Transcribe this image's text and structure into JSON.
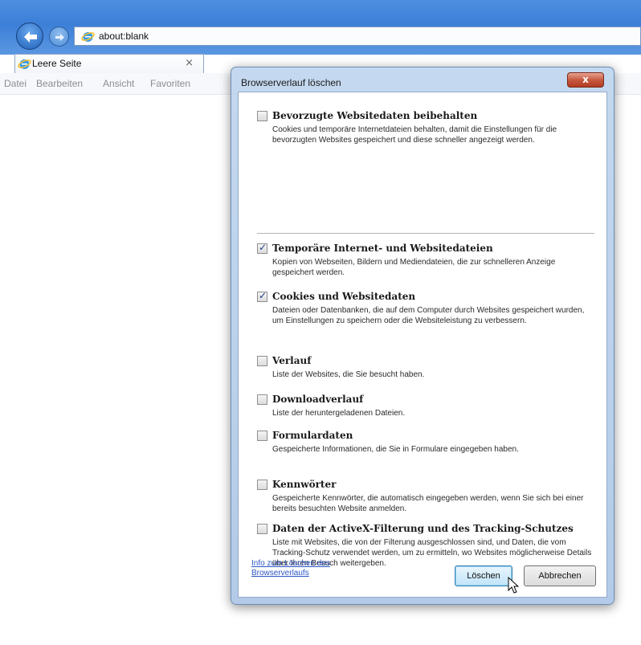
{
  "browser": {
    "address": "about:blank",
    "tab_label": "Leere Seite",
    "tab_close": "×",
    "menu": [
      "Datei",
      "Bearbeiten",
      "Ansicht",
      "Favoriten"
    ]
  },
  "dialog": {
    "title": "Browserverlauf löschen",
    "close_label": "x",
    "options": [
      {
        "checked": false,
        "title": "Bevorzugte Websitedaten beibehalten",
        "desc": "Cookies und temporäre Internetdateien behalten, damit die Einstellungen für die bevorzugten Websites gespeichert und diese schneller angezeigt werden."
      },
      {
        "checked": true,
        "title": "Temporäre Internet- und Websitedateien",
        "desc": "Kopien von Webseiten, Bildern und Mediendateien, die zur schnelleren Anzeige gespeichert werden."
      },
      {
        "checked": true,
        "title": "Cookies und Websitedaten",
        "desc": "Dateien oder Datenbanken, die auf dem Computer durch Websites gespeichert wurden, um Einstellungen zu speichern oder die Websiteleistung zu verbessern."
      },
      {
        "checked": false,
        "title": "Verlauf",
        "desc": "Liste der Websites, die Sie besucht haben."
      },
      {
        "checked": false,
        "title": "Downloadverlauf",
        "desc": "Liste der heruntergeladenen Dateien."
      },
      {
        "checked": false,
        "title": "Formulardaten",
        "desc": "Gespeicherte Informationen, die Sie in Formulare eingegeben haben."
      },
      {
        "checked": false,
        "title": "Kennwörter",
        "desc": "Gespeicherte Kennwörter, die automatisch eingegeben werden, wenn Sie sich bei einer bereits besuchten Website anmelden."
      },
      {
        "checked": false,
        "title": "Daten der ActiveX-Filterung und des Tracking-Schutzes",
        "desc": "Liste mit Websites, die von der Filterung ausgeschlossen sind, und Daten, die vom Tracking-Schutz verwendet werden, um zu ermitteln, wo Websites möglicherweise Details über Ihren Besuch weitergeben."
      }
    ],
    "info_link": "Info zum Löschen des Browserverlaufs",
    "delete_button": "Löschen",
    "cancel_button": "Abbrechen"
  },
  "colors": {
    "titlebar": "#3c7fd8",
    "dialog_frame": "#b3cbe8",
    "link": "#2b56c6",
    "checkmark": "#1d3f86"
  },
  "icons": [
    "back-arrow-icon",
    "forward-arrow-icon",
    "ie-logo-icon",
    "close-icon",
    "mouse-cursor-icon"
  ]
}
